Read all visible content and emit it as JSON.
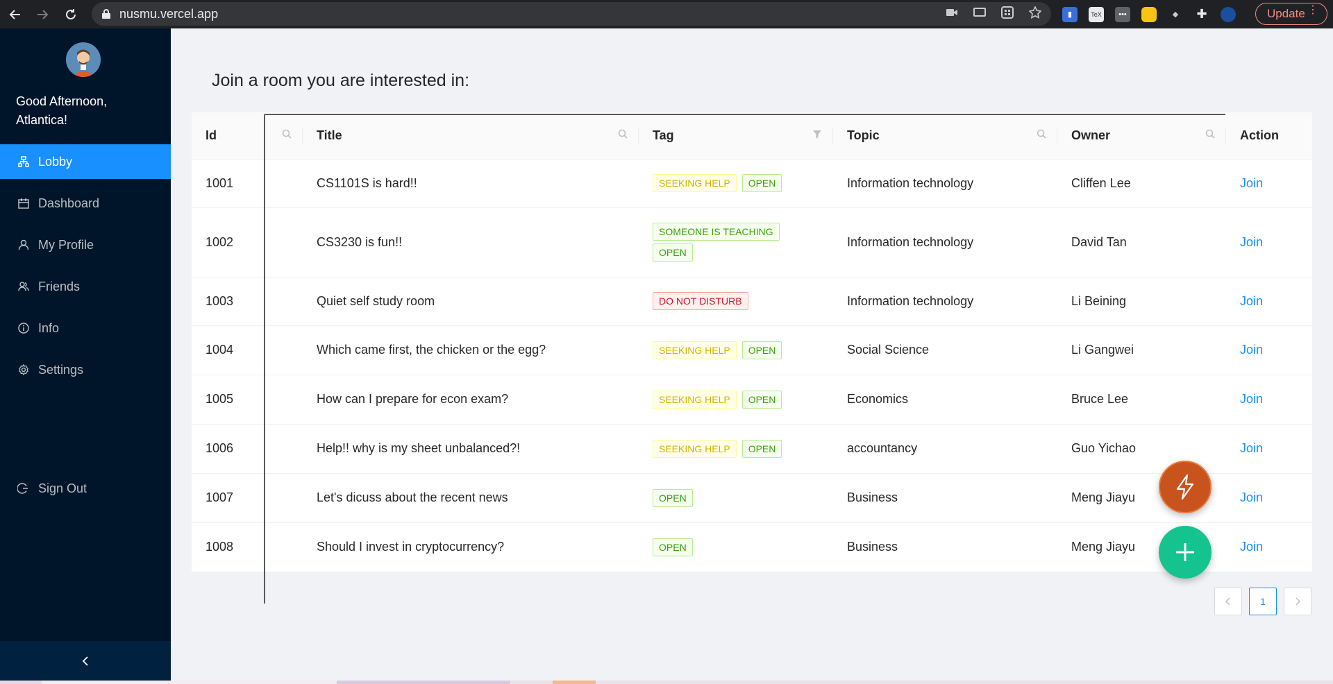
{
  "browser": {
    "url": "nusmu.vercel.app",
    "update_label": "Update"
  },
  "sidebar": {
    "greeting": "Good Afternoon, Atlantica!",
    "items": [
      {
        "label": "Lobby",
        "icon": "lobby-icon",
        "active": true
      },
      {
        "label": "Dashboard",
        "icon": "calendar-icon"
      },
      {
        "label": "My Profile",
        "icon": "user-icon"
      },
      {
        "label": "Friends",
        "icon": "team-icon"
      },
      {
        "label": "Info",
        "icon": "info-icon"
      },
      {
        "label": "Settings",
        "icon": "gear-icon"
      }
    ],
    "signout": "Sign Out",
    "collapse_icon": "chevron-left-icon"
  },
  "main": {
    "title": "Join a room you are interested in:"
  },
  "table": {
    "columns": [
      "Id",
      "Title",
      "Tag",
      "Topic",
      "Owner",
      "Action"
    ],
    "rows": [
      {
        "id": "1001",
        "title": "CS1101S is hard!!",
        "tags": [
          {
            "label": "SEEKING HELP",
            "color": "gold"
          },
          {
            "label": "OPEN",
            "color": "green"
          }
        ],
        "topic": "Information technology",
        "owner": "Cliffen Lee",
        "action": "Join"
      },
      {
        "id": "1002",
        "title": "CS3230 is fun!!",
        "tags": [
          {
            "label": "SOMEONE IS TEACHING",
            "color": "green"
          },
          {
            "label": "OPEN",
            "color": "green"
          }
        ],
        "topic": "Information technology",
        "owner": "David Tan",
        "action": "Join"
      },
      {
        "id": "1003",
        "title": "Quiet self study room",
        "tags": [
          {
            "label": "DO NOT DISTURB",
            "color": "red"
          }
        ],
        "topic": "Information technology",
        "owner": "Li Beining",
        "action": "Join"
      },
      {
        "id": "1004",
        "title": "Which came first, the chicken or the egg?",
        "tags": [
          {
            "label": "SEEKING HELP",
            "color": "gold"
          },
          {
            "label": "OPEN",
            "color": "green"
          }
        ],
        "topic": "Social Science",
        "owner": "Li Gangwei",
        "action": "Join"
      },
      {
        "id": "1005",
        "title": "How can I prepare for econ exam?",
        "tags": [
          {
            "label": "SEEKING HELP",
            "color": "gold"
          },
          {
            "label": "OPEN",
            "color": "green"
          }
        ],
        "topic": "Economics",
        "owner": "Bruce Lee",
        "action": "Join"
      },
      {
        "id": "1006",
        "title": "Help!! why is my sheet unbalanced?!",
        "tags": [
          {
            "label": "SEEKING HELP",
            "color": "gold"
          },
          {
            "label": "OPEN",
            "color": "green"
          }
        ],
        "topic": "accountancy",
        "owner": "Guo Yichao",
        "action": "Join"
      },
      {
        "id": "1007",
        "title": "Let's dicuss about the recent news",
        "tags": [
          {
            "label": "OPEN",
            "color": "green"
          }
        ],
        "topic": "Business",
        "owner": "Meng Jiayu",
        "action": "Join"
      },
      {
        "id": "1008",
        "title": "Should I invest in cryptocurrency?",
        "tags": [
          {
            "label": "OPEN",
            "color": "green"
          }
        ],
        "topic": "Business",
        "owner": "Meng Jiayu",
        "action": "Join"
      }
    ]
  },
  "pagination": {
    "current_page": "1"
  },
  "colors": {
    "sidebar_bg": "#001529",
    "accent": "#1890ff",
    "fab_orange": "#c8531c",
    "fab_green": "#14c38e"
  }
}
